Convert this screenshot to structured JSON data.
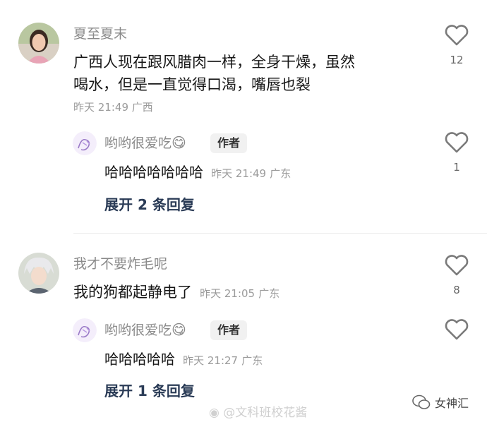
{
  "comments": [
    {
      "username": "夏至夏末",
      "text_line1": "广西人现在跟风腊肉一样，全身干燥，虽然",
      "text_line2": "喝水，但是一直觉得口渴，嘴唇也裂",
      "time": "昨天 21:49",
      "location": "广西",
      "likes": "12",
      "avatar_icon": "user-photo-icon",
      "reply": {
        "username": "哟哟很爱吃",
        "emoji": "😋",
        "badge": "作者",
        "text": "哈哈哈哈哈哈哈",
        "time": "昨天 21:49",
        "location": "广东",
        "likes": "1",
        "avatar_icon": "sketch-avatar-icon"
      },
      "expand_label": "展开 2 条回复"
    },
    {
      "username": "我才不要炸毛呢",
      "text": "我的狗都起静电了",
      "time": "昨天 21:05",
      "location": "广东",
      "likes": "8",
      "avatar_icon": "anime-avatar-icon",
      "reply": {
        "username": "哟哟很爱吃",
        "emoji": "😋",
        "badge": "作者",
        "text": "哈哈哈哈哈",
        "time": "昨天 21:27",
        "location": "广东",
        "likes": "",
        "avatar_icon": "sketch-avatar-icon"
      },
      "expand_label": "展开 1 条回复"
    }
  ],
  "watermarks": {
    "weibo": "@文科班校花酱",
    "wechat": "女神汇"
  },
  "colors": {
    "name": "#8a8a8a",
    "meta": "#9b9b9b",
    "expand": "#2a3b56",
    "heart": "#7a7a7a"
  }
}
